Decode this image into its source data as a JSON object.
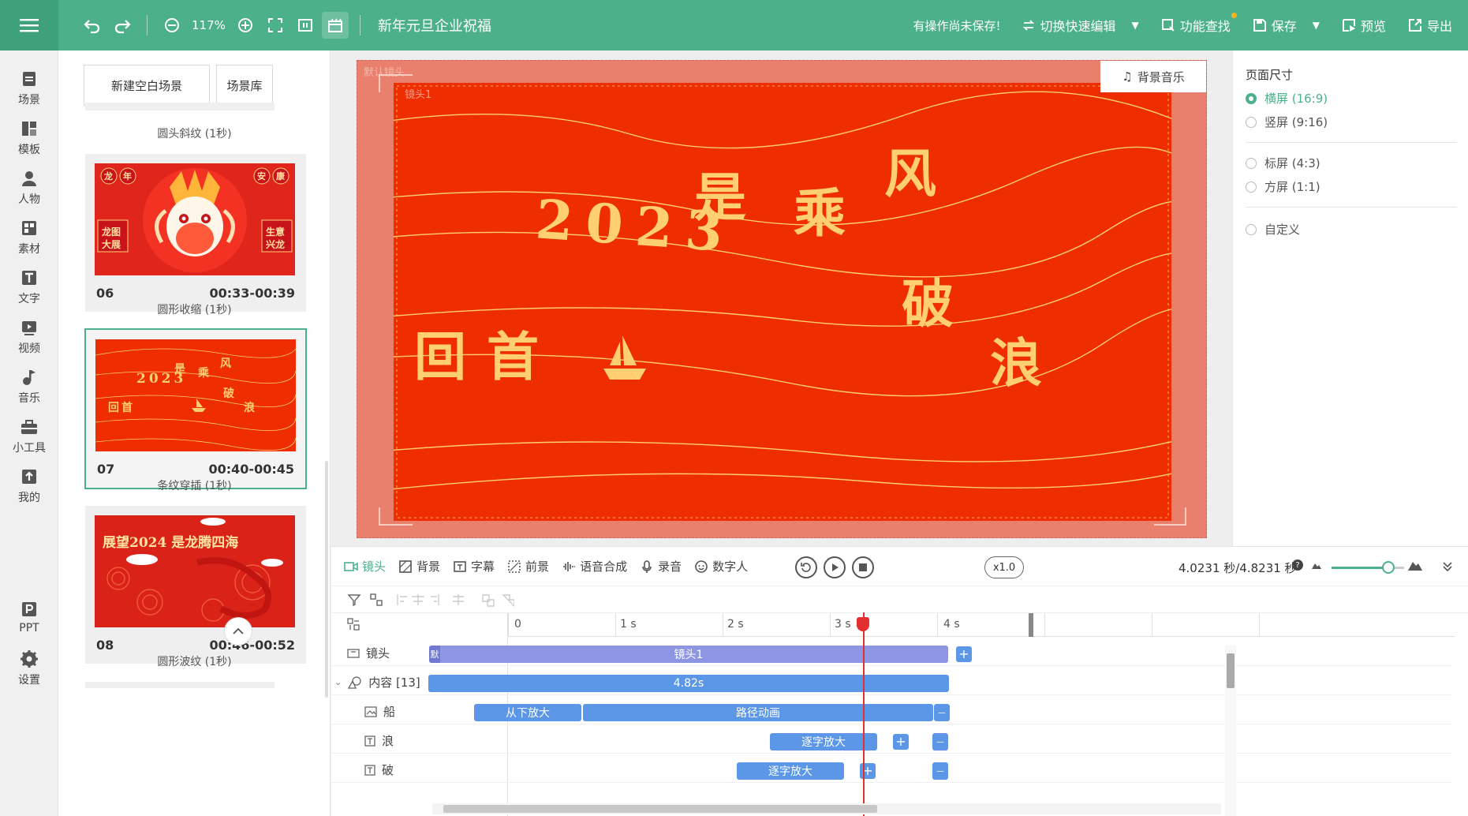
{
  "topbar": {
    "title": "新年元旦企业祝福",
    "zoom": "117%",
    "unsaved_notice": "有操作尚未保存!",
    "switch_edit": "切换快速编辑",
    "feature_search": "功能查找",
    "save": "保存",
    "preview": "预览",
    "export": "导出"
  },
  "rail": [
    {
      "label": "场景",
      "icon": "scene-icon"
    },
    {
      "label": "模板",
      "icon": "template-icon"
    },
    {
      "label": "人物",
      "icon": "person-icon"
    },
    {
      "label": "素材",
      "icon": "material-icon"
    },
    {
      "label": "文字",
      "icon": "text-icon"
    },
    {
      "label": "视频",
      "icon": "video-icon"
    },
    {
      "label": "音乐",
      "icon": "music-icon"
    },
    {
      "label": "小工具",
      "icon": "toolbox-icon"
    },
    {
      "label": "我的",
      "icon": "upload-icon"
    },
    {
      "label": "PPT",
      "icon": "ppt-icon"
    },
    {
      "label": "设置",
      "icon": "settings-icon"
    }
  ],
  "scenes_panel": {
    "new_blank": "新建空白场景",
    "library": "场景库",
    "transitions": [
      "圆头斜纹 (1秒)",
      "圆形收缩 (1秒)",
      "条纹穿插 (1秒)",
      "圆形波纹 (1秒)"
    ],
    "cards": [
      {
        "num": "06",
        "time": "00:33-00:39",
        "thumb_text": [
          "龙",
          "年",
          "安",
          "康",
          "龙图",
          "大展",
          "生意",
          "兴龙"
        ]
      },
      {
        "num": "07",
        "time": "00:40-00:45",
        "thumb_text": [
          "2023",
          "是",
          "乘",
          "风",
          "破",
          "回首",
          "浪"
        ]
      },
      {
        "num": "08",
        "time": "00:46-00:52",
        "thumb_text": [
          "展望2024 是龙腾四海"
        ]
      }
    ]
  },
  "stage": {
    "defaults_tag": "默认镜头",
    "camera_tag": "镜头1",
    "bgm_button": "背景音乐",
    "chars": {
      "shi": "是",
      "cheng": "乘",
      "feng": "风",
      "year": "2023",
      "po": "破",
      "huishou": "回首",
      "lang": "浪"
    }
  },
  "props": {
    "heading": "页面尺寸",
    "options": [
      {
        "label": "横屏 (16:9)",
        "selected": true
      },
      {
        "label": "竖屏 (9:16)",
        "selected": false
      },
      {
        "label": "标屏 (4:3)",
        "selected": false
      },
      {
        "label": "方屏 (1:1)",
        "selected": false
      },
      {
        "label": "自定义",
        "selected": false
      }
    ]
  },
  "timeline": {
    "tabs": [
      "镜头",
      "背景",
      "字幕",
      "前景",
      "语音合成",
      "录音",
      "数字人"
    ],
    "speed": "x1.0",
    "time_readout": "4.0231 秒/4.8231 秒",
    "ruler": [
      "0",
      "1 s",
      "2 s",
      "3 s",
      "4 s"
    ],
    "playhead_seconds": 4.0231,
    "duration_seconds": 4.8231,
    "rows": [
      {
        "label": "镜头",
        "bar": "镜头1",
        "tag": "默"
      },
      {
        "label": "内容 [13]",
        "bar": "4.82s"
      },
      {
        "label": "船",
        "bars": [
          "从下放大",
          "路径动画"
        ]
      },
      {
        "label": "浪",
        "bars": [
          "逐字放大"
        ]
      },
      {
        "label": "破",
        "bars": [
          "逐字放大"
        ]
      }
    ],
    "accent": "#4cb08b",
    "playhead_color": "#e23030"
  }
}
